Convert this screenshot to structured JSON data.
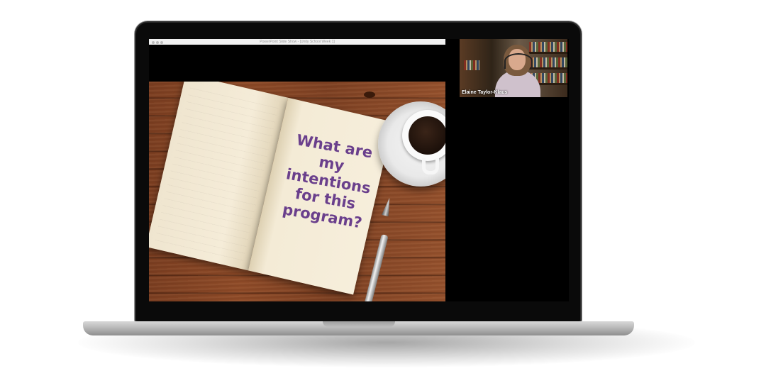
{
  "window": {
    "title": "PowerPoint Slide Show - [Unity School Week 1]"
  },
  "slide": {
    "text_lines": [
      "What are my",
      "intentions",
      "for this",
      "program?"
    ]
  },
  "participant": {
    "name": "Elaine Taylor-Klaus"
  },
  "colors": {
    "handwriting": "#6a3f8c",
    "screen_bg": "#000000"
  }
}
